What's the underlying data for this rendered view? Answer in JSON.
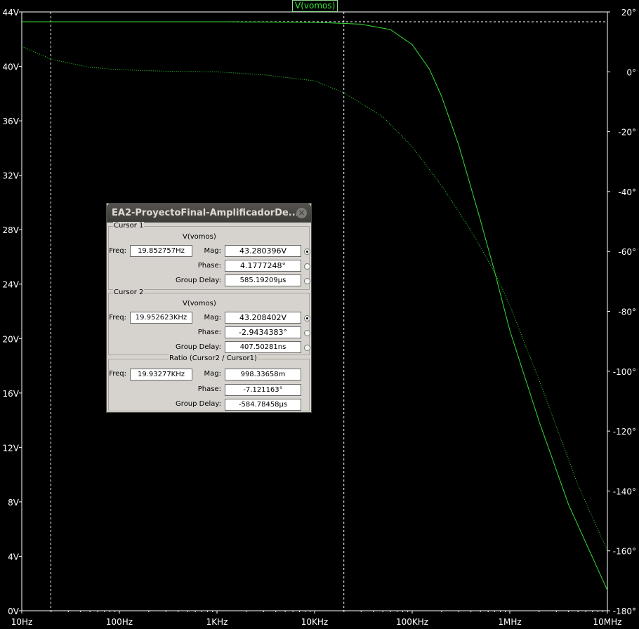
{
  "trace_title": "V(vomos)",
  "colors": {
    "trace": "#33dd33",
    "axis": "#ffffff",
    "background": "#000000"
  },
  "chart_data": {
    "type": "line",
    "x_scale": "log",
    "xlim": [
      10,
      10000000
    ],
    "x_tick_labels": [
      "10Hz",
      "100Hz",
      "1KHz",
      "10KHz",
      "100KHz",
      "1MHz",
      "10MHz"
    ],
    "y_left_tick_labels": [
      "44V",
      "40V",
      "36V",
      "32V",
      "28V",
      "24V",
      "20V",
      "16V",
      "12V",
      "8V",
      "4V",
      "0V"
    ],
    "y_left_lim": [
      0,
      44
    ],
    "y_right_tick_labels": [
      "20°",
      "0°",
      "-20°",
      "-40°",
      "-60°",
      "-80°",
      "-100°",
      "-120°",
      "-140°",
      "-160°",
      "-180°"
    ],
    "y_right_lim": [
      -180,
      20
    ],
    "cursors_x": [
      19.852757,
      19952.623
    ],
    "series": [
      {
        "name": "V(vomos)",
        "axis": "magnitude",
        "style": "solid",
        "x": [
          10,
          100,
          1000,
          10000,
          30000,
          60000,
          100000,
          150000,
          200000,
          300000,
          500000,
          700000,
          1000000,
          2000000,
          4000000,
          10000000
        ],
        "y": [
          43.28,
          43.28,
          43.28,
          43.24,
          43.1,
          42.7,
          41.6,
          39.8,
          37.8,
          34.2,
          28.7,
          24.9,
          20.6,
          13.9,
          7.8,
          1.5
        ]
      },
      {
        "name": "V(vomos)",
        "axis": "phase",
        "style": "dotted",
        "x": [
          10,
          20,
          50,
          100,
          300,
          1000,
          3000,
          10000,
          20000,
          50000,
          100000,
          200000,
          400000,
          700000,
          1000000,
          2000000,
          5000000,
          10000000
        ],
        "y": [
          8.5,
          4.2,
          1.5,
          0.7,
          0.2,
          0,
          -1,
          -3,
          -7,
          -15,
          -25,
          -38,
          -53,
          -67,
          -78,
          -103,
          -138,
          -160
        ]
      }
    ]
  },
  "dialog": {
    "title": "EA2-ProyectoFinal-AmplificadorDe...",
    "close_glyph": "×",
    "cursor1": {
      "group_label": "Cursor 1",
      "trace": "V(vomos)",
      "freq_label": "Freq:",
      "freq": "19.852757Hz",
      "mag_label": "Mag:",
      "mag": "43.280396V",
      "phase_label": "Phase:",
      "phase": "4.1777248°",
      "gd_label": "Group Delay:",
      "gd": "585.19209µs"
    },
    "cursor2": {
      "group_label": "Cursor 2",
      "trace": "V(vomos)",
      "freq_label": "Freq:",
      "freq": "19.952623KHz",
      "mag_label": "Mag:",
      "mag": "43.208402V",
      "phase_label": "Phase:",
      "phase": "-2.9434383°",
      "gd_label": "Group Delay:",
      "gd": "407.50281ns"
    },
    "ratio": {
      "group_label": "Ratio (Cursor2 / Cursor1)",
      "freq_label": "Freq:",
      "freq": "19.93277KHz",
      "mag_label": "Mag:",
      "mag": "998.33658m",
      "phase_label": "Phase:",
      "phase": "-7.121163°",
      "gd_label": "Group Delay:",
      "gd": "-584.78458µs"
    }
  }
}
